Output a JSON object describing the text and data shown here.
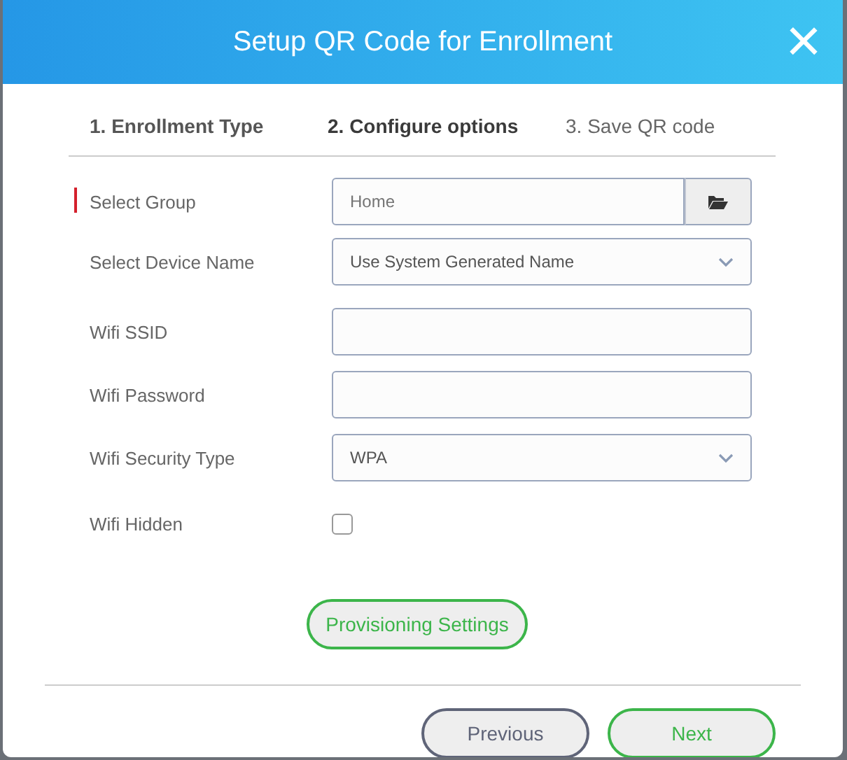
{
  "dialog": {
    "title": "Setup QR Code for Enrollment",
    "close_glyph": "×"
  },
  "steps": [
    {
      "label": "1. Enrollment Type",
      "kind": "done",
      "selected": false
    },
    {
      "label": "2. Configure options",
      "kind": "current",
      "selected": true
    },
    {
      "label": "3. Save QR code",
      "kind": "upcoming",
      "selected": false
    }
  ],
  "fields": [
    {
      "kind": "picker",
      "label": "Select Group",
      "required": true,
      "placeholder": "Home"
    },
    {
      "kind": "select",
      "label": "Select Device Name",
      "required": false,
      "value": "Use System Generated Name"
    },
    {
      "kind": "text",
      "label": "Wifi SSID",
      "required": false
    },
    {
      "kind": "text",
      "label": "Wifi Password",
      "required": false
    },
    {
      "kind": "select",
      "label": "Wifi Security Type",
      "required": false,
      "value": "WPA"
    },
    {
      "kind": "checkbox",
      "label": "Wifi Hidden",
      "required": false,
      "checked": false
    }
  ],
  "provisioning_button": "Provisioning Settings",
  "buttons": [
    {
      "label": "Previous",
      "kind": "secondary"
    },
    {
      "label": "Next",
      "kind": "primary"
    }
  ]
}
